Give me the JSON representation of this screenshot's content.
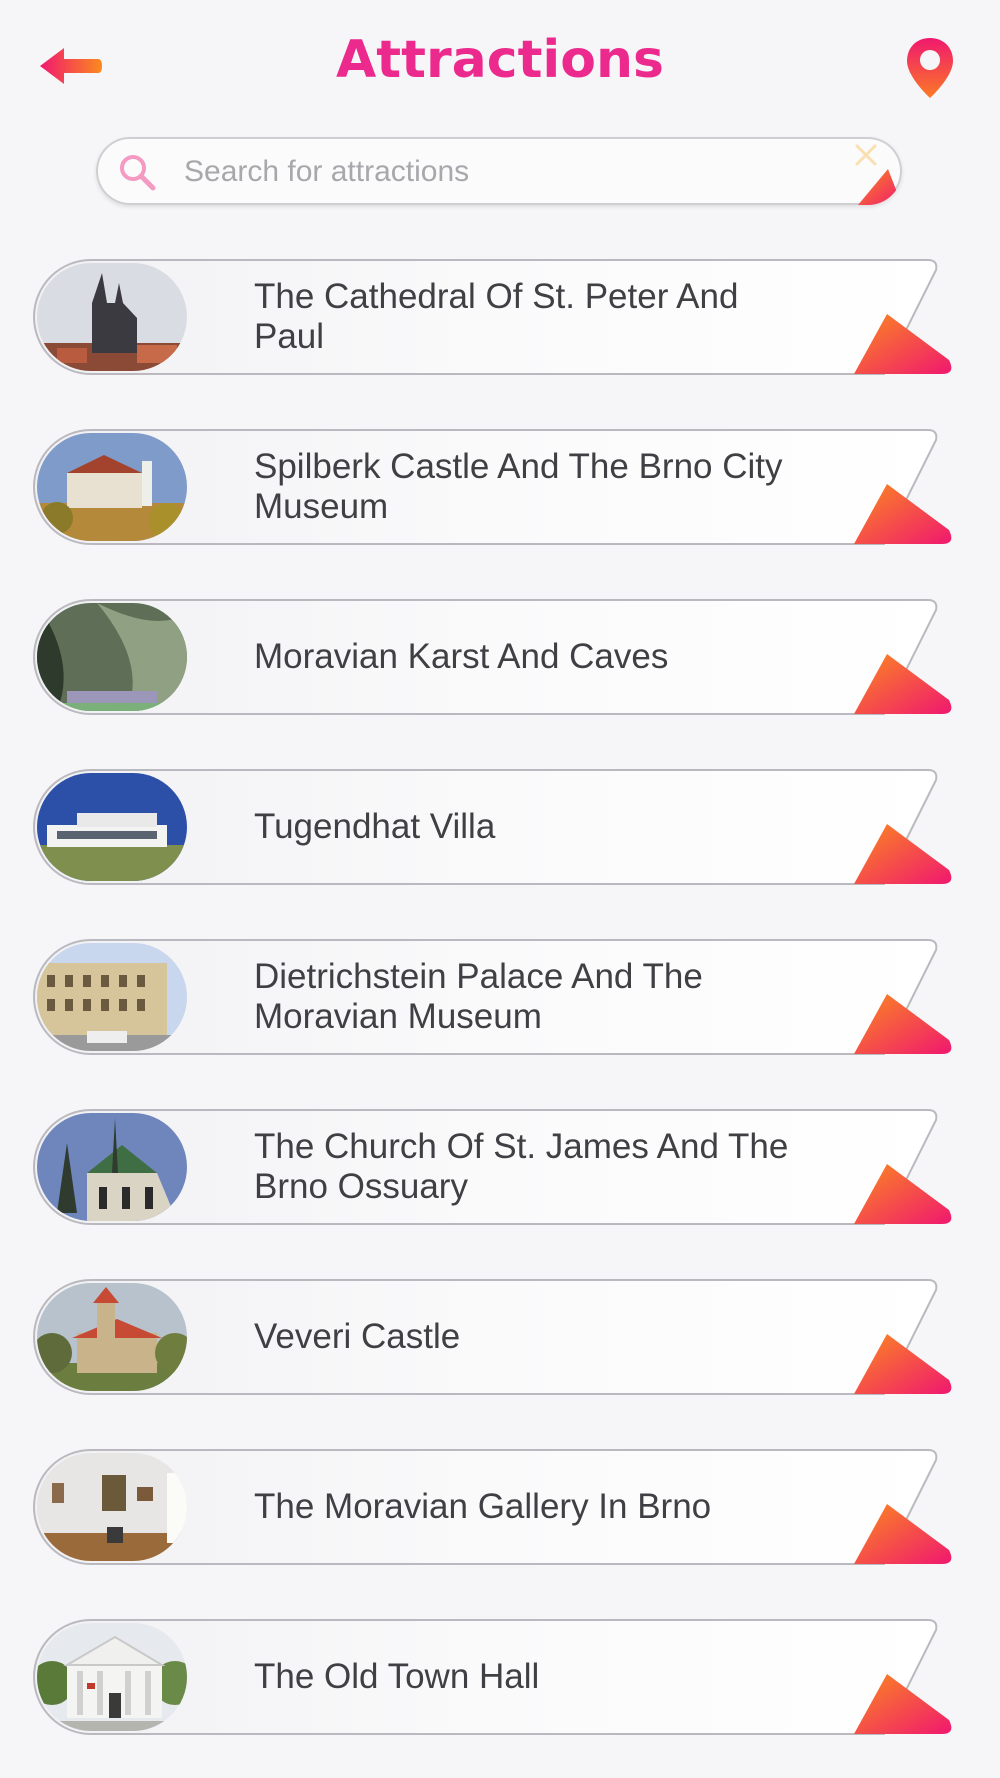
{
  "header": {
    "title": "Attractions",
    "back_icon": "back-arrow-icon",
    "map_icon": "map-pin-icon"
  },
  "search": {
    "placeholder": "Search for attractions",
    "value": "",
    "icon": "search-icon",
    "clear_icon": "close-icon"
  },
  "colors": {
    "accent_pink": "#ec2a8e",
    "accent_orange": "#f7702a",
    "background": "#f6f6f8",
    "text": "#3f3f44"
  },
  "attractions": [
    {
      "name": "The Cathedral Of St. Peter And Paul"
    },
    {
      "name": "Spilberk Castle And The Brno City Museum"
    },
    {
      "name": "Moravian Karst And Caves"
    },
    {
      "name": "Tugendhat Villa"
    },
    {
      "name": "Dietrichstein Palace And The Moravian Museum"
    },
    {
      "name": "The Church Of St. James And The Brno Ossuary"
    },
    {
      "name": "Veveri Castle"
    },
    {
      "name": "The Moravian Gallery In Brno"
    },
    {
      "name": "The Old Town Hall"
    }
  ]
}
